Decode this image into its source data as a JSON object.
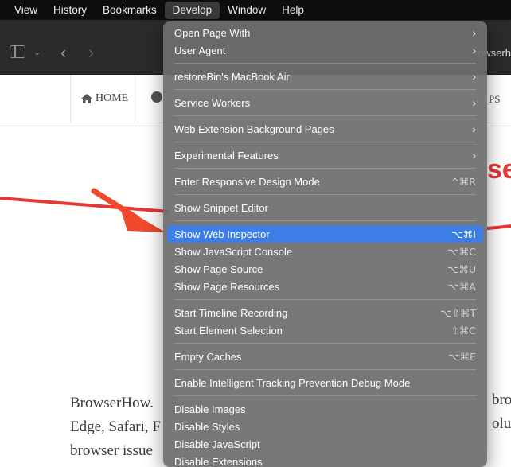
{
  "menubar": {
    "items": [
      "View",
      "History",
      "Bookmarks",
      "Develop",
      "Window",
      "Help"
    ],
    "active": "Develop"
  },
  "toolbar": {
    "tab_fragment": "owserh"
  },
  "site": {
    "nav_home": "HOME",
    "nav_tips_fragment": "PS",
    "heading_fragment": "se",
    "paragraph_lines": [
      "BrowserHow.",
      "Edge, Safari, F",
      "browser issue"
    ],
    "right_fragments": [
      "bro",
      "oluti"
    ]
  },
  "develop_menu": {
    "groups": [
      [
        {
          "label": "Open Page With",
          "shortcut": "",
          "submenu": true
        },
        {
          "label": "User Agent",
          "shortcut": "",
          "submenu": true
        }
      ],
      [
        {
          "label": "restoreBin's MacBook Air",
          "shortcut": "",
          "submenu": true
        }
      ],
      [
        {
          "label": "Service Workers",
          "shortcut": "",
          "submenu": true
        }
      ],
      [
        {
          "label": "Web Extension Background Pages",
          "shortcut": "",
          "submenu": true
        }
      ],
      [
        {
          "label": "Experimental Features",
          "shortcut": "",
          "submenu": true
        }
      ],
      [
        {
          "label": "Enter Responsive Design Mode",
          "shortcut": "^⌘R",
          "submenu": false
        }
      ],
      [
        {
          "label": "Show Snippet Editor",
          "shortcut": "",
          "submenu": false
        }
      ],
      [
        {
          "label": "Show Web Inspector",
          "shortcut": "⌥⌘I",
          "submenu": false,
          "selected": true
        },
        {
          "label": "Show JavaScript Console",
          "shortcut": "⌥⌘C",
          "submenu": false
        },
        {
          "label": "Show Page Source",
          "shortcut": "⌥⌘U",
          "submenu": false
        },
        {
          "label": "Show Page Resources",
          "shortcut": "⌥⌘A",
          "submenu": false
        }
      ],
      [
        {
          "label": "Start Timeline Recording",
          "shortcut": "⌥⇧⌘T",
          "submenu": false
        },
        {
          "label": "Start Element Selection",
          "shortcut": "⇧⌘C",
          "submenu": false
        }
      ],
      [
        {
          "label": "Empty Caches",
          "shortcut": "⌥⌘E",
          "submenu": false
        }
      ],
      [
        {
          "label": "Enable Intelligent Tracking Prevention Debug Mode",
          "shortcut": "",
          "submenu": false
        }
      ],
      [
        {
          "label": "Disable Images",
          "shortcut": "",
          "submenu": false
        },
        {
          "label": "Disable Styles",
          "shortcut": "",
          "submenu": false
        },
        {
          "label": "Disable JavaScript",
          "shortcut": "",
          "submenu": false
        },
        {
          "label": "Disable Extensions",
          "shortcut": "",
          "submenu": false
        }
      ]
    ]
  },
  "colors": {
    "selection": "#3c7ee6",
    "annotation_arrow": "#e53935"
  }
}
